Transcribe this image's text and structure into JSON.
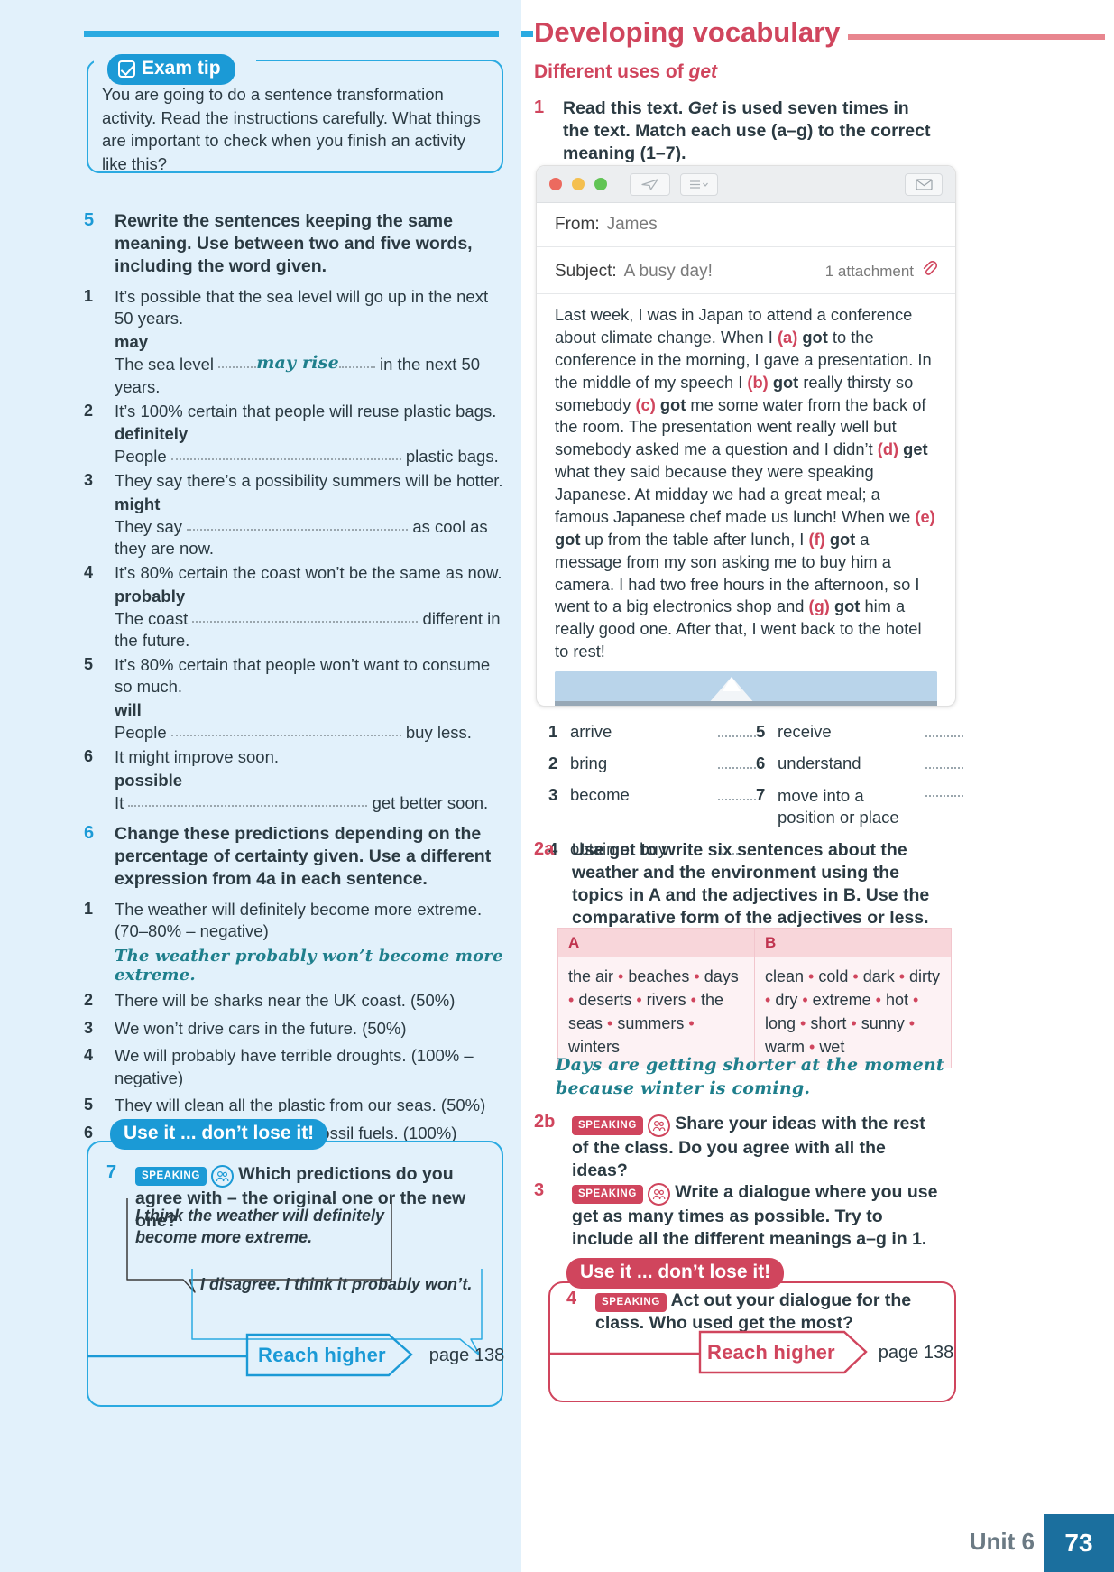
{
  "page": {
    "unit_label": "Unit 6",
    "page_number": "73"
  },
  "left": {
    "exam_tip": {
      "badge": "Exam tip",
      "icon": "checkbox-icon",
      "text": "You are going to do a sentence transformation activity. Read the instructions carefully. What things are important to check when you finish an activity like this?"
    },
    "ex5": {
      "number": "5",
      "instruction": "Rewrite the sentences keeping the same meaning. Use between two and five words, including the word given.",
      "items": [
        {
          "n": "1",
          "prompt": "It’s possible that the sea level will go up in the next 50 years.",
          "cue": "may",
          "answer_pre": "The sea level",
          "answer_written": "may rise",
          "answer_post": "in the next 50 years."
        },
        {
          "n": "2",
          "prompt": "It’s 100% certain that people will reuse plastic bags.",
          "cue": "definitely",
          "answer_pre": "People",
          "answer_written": "",
          "answer_post": "plastic bags."
        },
        {
          "n": "3",
          "prompt": "They say there’s a possibility summers will be hotter.",
          "cue": "might",
          "answer_pre": "They say",
          "answer_written": "",
          "answer_post": "as cool as they are now."
        },
        {
          "n": "4",
          "prompt": "It’s 80% certain the coast won’t be the same as now.",
          "cue": "probably",
          "answer_pre": "The coast",
          "answer_written": "",
          "answer_post": "different in the future."
        },
        {
          "n": "5",
          "prompt": "It’s 80% certain that people won’t want to consume so much.",
          "cue": "will",
          "answer_pre": "People",
          "answer_written": "",
          "answer_post": "buy less."
        },
        {
          "n": "6",
          "prompt": "It might improve soon.",
          "cue": "possible",
          "answer_pre": "It",
          "answer_written": "",
          "answer_post": "get better soon."
        }
      ]
    },
    "ex6": {
      "number": "6",
      "instruction": "Change these predictions depending on the percentage of certainty given. Use a different expression from 4a in each sentence.",
      "items": [
        {
          "n": "1",
          "text": "The weather will definitely become more extreme. (70–80% – negative)"
        },
        {
          "n": "2",
          "text": "There will be sharks near the UK coast. (50%)"
        },
        {
          "n": "3",
          "text": "We won’t drive cars in the future. (50%)"
        },
        {
          "n": "4",
          "text": "We will probably have terrible droughts. (100% – negative)"
        },
        {
          "n": "5",
          "text": "They will clean all the plastic from our seas. (50%)"
        },
        {
          "n": "6",
          "text": "Perhaps we will stop using fossil fuels. (100%)"
        }
      ],
      "example_answer": "The weather probably won’t become more extreme."
    },
    "use_it": {
      "badge": "Use it ... don’t lose it!",
      "ex7": {
        "number": "7",
        "speaking_pill": "SPEAKING",
        "speaking_icon": "pair-speaking-icon",
        "instruction": "Which predictions do you agree with – the original one or the new one?"
      },
      "bubble1": "I think the weather will definitely become more extreme.",
      "bubble2": "I disagree. I think it probably won’t."
    },
    "reach_higher": {
      "label": "Reach higher",
      "page_ref": "page 138"
    }
  },
  "right": {
    "heading": "Developing vocabulary",
    "subheading_pre": "Different uses of ",
    "subheading_italic": "get",
    "ex1": {
      "number": "1",
      "instruction_parts": [
        "Read this text. ",
        "Get",
        " is used seven times in the text. Match each use (a–g) to the correct meaning (1–7)."
      ]
    },
    "email": {
      "window_dots": [
        "close-dot",
        "minimise-dot",
        "maximise-dot"
      ],
      "toolbar_icons": [
        "send-icon",
        "list-menu-icon",
        "envelope-icon"
      ],
      "from_label": "From:",
      "from_value": "James",
      "subject_label": "Subject:",
      "subject_value": "A busy day!",
      "attachment_label": "1 attachment",
      "attachment_icon": "paperclip-icon",
      "body_segments": [
        {
          "t": "Last week, I was in Japan to attend a conference about climate change. When I "
        },
        {
          "t": "(a)",
          "k": "tag"
        },
        {
          "t": " "
        },
        {
          "t": "got",
          "k": "g"
        },
        {
          "t": " to the conference in the morning, I gave a presentation. In the middle of my speech I "
        },
        {
          "t": "(b)",
          "k": "tag"
        },
        {
          "t": " "
        },
        {
          "t": "got",
          "k": "g"
        },
        {
          "t": " really thirsty so somebody "
        },
        {
          "t": "(c)",
          "k": "tag"
        },
        {
          "t": " "
        },
        {
          "t": "got",
          "k": "g"
        },
        {
          "t": " me some water from the back of the room. The presentation went really well but somebody asked me a question and I didn’t "
        },
        {
          "t": "(d)",
          "k": "tag"
        },
        {
          "t": " "
        },
        {
          "t": "get",
          "k": "g"
        },
        {
          "t": " what they said because they were speaking Japanese. At midday we had a great meal; a famous Japanese chef made us lunch! When we "
        },
        {
          "t": "(e)",
          "k": "tag"
        },
        {
          "t": " "
        },
        {
          "t": "got",
          "k": "g"
        },
        {
          "t": " up from the table after lunch, I "
        },
        {
          "t": "(f)",
          "k": "tag"
        },
        {
          "t": " "
        },
        {
          "t": "got",
          "k": "g"
        },
        {
          "t": " a message from my son asking me to buy him a camera. I had two free hours in the afternoon, so I went to a big electronics shop and "
        },
        {
          "t": "(g)",
          "k": "tag"
        },
        {
          "t": " "
        },
        {
          "t": "got",
          "k": "g"
        },
        {
          "t": " him a really good one. After that, I went back to the hotel to rest!"
        }
      ],
      "image_alt": "tokyo-skyline-photo"
    },
    "meanings_left": [
      {
        "n": "1",
        "w": "arrive"
      },
      {
        "n": "2",
        "w": "bring"
      },
      {
        "n": "3",
        "w": "become"
      },
      {
        "n": "4",
        "w": "obtain or buy"
      }
    ],
    "meanings_right": [
      {
        "n": "5",
        "w": "receive"
      },
      {
        "n": "6",
        "w": "understand"
      },
      {
        "n": "7",
        "w": "move into a position or place"
      }
    ],
    "ex2a": {
      "number": "2a",
      "instruction": "Use get to write six sentences about the weather and the environment using the topics in A and the adjectives in B. Use the comparative form of the adjectives or less.",
      "table": {
        "headers": [
          "A",
          "B"
        ],
        "col_a": [
          "the air",
          "beaches",
          "days",
          "deserts",
          "rivers",
          "the seas",
          "summers",
          "winters"
        ],
        "col_b": [
          "clean",
          "cold",
          "dark",
          "dirty",
          "dry",
          "extreme",
          "hot",
          "long",
          "short",
          "sunny",
          "warm",
          "wet"
        ]
      },
      "example_answer": "Days are getting shorter at the moment because winter is coming."
    },
    "ex2b": {
      "number": "2b",
      "speaking_pill": "SPEAKING",
      "instruction": "Share your ideas with the rest of the class. Do you agree with all the ideas?"
    },
    "ex3": {
      "number": "3",
      "speaking_pill": "SPEAKING",
      "instruction": "Write a dialogue where you use get as many times as possible. Try to include all the different meanings a–g in 1."
    },
    "use_it": {
      "badge": "Use it ... don’t lose it!",
      "ex4": {
        "number": "4",
        "speaking_pill": "SPEAKING",
        "instruction": "Act out your dialogue for the class. Who used get the most?"
      }
    },
    "reach_higher": {
      "label": "Reach higher",
      "page_ref": "page 138"
    }
  },
  "colors": {
    "blue": "#1b9ad6",
    "blue_light": "#2aaae1",
    "panel_blue": "#e2f1fb",
    "red": "#d0455d",
    "teal_hand": "#1f7f8c",
    "footer_tab": "#1b6f9e"
  }
}
